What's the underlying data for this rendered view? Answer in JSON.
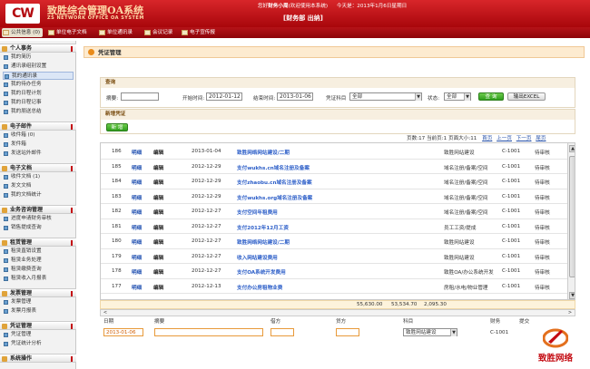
{
  "header": {
    "system_name": "致胜综合管理OA系统",
    "system_name_en": "ZS NETWORK OFFICE OA SYSTEM",
    "welcome_prefix": "您好",
    "user": "财务小周",
    "welcome_suffix": "(欢迎使用本系统)",
    "date_text": "今天是：2013年1月6日星期日",
    "links": "[财务部 出纳]"
  },
  "tabs": [
    "公共信息 (0)",
    "单位电子文档",
    "单位通讯录",
    "会议记录",
    "电子宣传报"
  ],
  "sidebar": {
    "sections": [
      {
        "title": "个人事务",
        "items": [
          "我的简历",
          "通讯录组别设置",
          "我的通讯录",
          "我的待办任务",
          "我的日程计划",
          "我的日程记事",
          "我的朋送总结"
        ]
      },
      {
        "title": "电子邮件",
        "items": [
          "收件箱 (0)",
          "发件箱",
          "发送站外邮件"
        ]
      },
      {
        "title": "电子文档",
        "items": [
          "收件文档 (1)",
          "发文文档",
          "我的文档统计"
        ]
      },
      {
        "title": "业务咨询管理",
        "items": [
          "进度申请财务审核",
          "销售提成查询"
        ]
      },
      {
        "title": "租赁管理",
        "items": [
          "租赁直销设置",
          "租赁业务处理",
          "租赁缴费查询",
          "租赁收入月报表"
        ]
      },
      {
        "title": "发票管理",
        "items": [
          "发票管理",
          "发票月报表"
        ]
      },
      {
        "title": "凭证管理",
        "items": [
          "凭证管理",
          "凭证统计分析"
        ]
      },
      {
        "title": "系统操作",
        "items": []
      }
    ],
    "active_item": "我的通讯录"
  },
  "page": {
    "title": "凭证管理"
  },
  "query": {
    "panel_title": "查询",
    "summary_label": "摘要:",
    "summary_value": "",
    "start_label": "开始时间:",
    "start_value": "2012-01-12",
    "end_label": "结束时间:",
    "end_value": "2013-01-06",
    "subject_label": "凭证科目",
    "subject_value": "全部",
    "status_label": "状态:",
    "status_value": "全部",
    "query_button": "查 询",
    "export_button": "输出EXCEL"
  },
  "add": {
    "panel_title": "新增凭证",
    "add_button": "新 增"
  },
  "pager": {
    "text": "页数:17  当前页:1  页面大小:11",
    "first": "首页",
    "prev": "上一页",
    "next": "下一页",
    "last": "尾页"
  },
  "rows": [
    {
      "id": "186",
      "detail": "明细",
      "edit": "编辑",
      "date": "2013-01-04",
      "summary": "致胜网络网站建设/二期",
      "account": "致胜网站建设",
      "code": "C-1001",
      "status": "待审核"
    },
    {
      "id": "185",
      "detail": "明细",
      "edit": "编辑",
      "date": "2012-12-29",
      "summary": "支付wukhs.cn域名注册及备案",
      "account": "域名注册/备案/空间",
      "code": "C-1001",
      "status": "待审核"
    },
    {
      "id": "184",
      "detail": "明细",
      "edit": "编辑",
      "date": "2012-12-29",
      "summary": "支付zhaobu.cn域名注册及备案",
      "account": "域名注册/备案/空间",
      "code": "C-1001",
      "status": "待审核"
    },
    {
      "id": "183",
      "detail": "明细",
      "edit": "编辑",
      "date": "2012-12-29",
      "summary": "支付wukhs.org域名注册及备案",
      "account": "域名注册/备案/空间",
      "code": "C-1001",
      "status": "待审核"
    },
    {
      "id": "182",
      "detail": "明细",
      "edit": "编辑",
      "date": "2012-12-27",
      "summary": "支付空间年租费用",
      "account": "域名注册/备案/空间",
      "code": "C-1001",
      "status": "待审核"
    },
    {
      "id": "181",
      "detail": "明细",
      "edit": "编辑",
      "date": "2012-12-27",
      "summary": "支付2012年12月工资",
      "account": "员工工资/提成",
      "code": "C-1001",
      "status": "待审核"
    },
    {
      "id": "180",
      "detail": "明细",
      "edit": "编辑",
      "date": "2012-12-27",
      "summary": "致胜网络网站建设/二期",
      "account": "致胜网站建设",
      "code": "C-1001",
      "status": "待审核"
    },
    {
      "id": "179",
      "detail": "明细",
      "edit": "编辑",
      "date": "2012-12-27",
      "summary": "收入网站建设费用",
      "account": "致胜网站建设",
      "code": "C-1001",
      "status": "待审核"
    },
    {
      "id": "178",
      "detail": "明细",
      "edit": "编辑",
      "date": "2012-12-27",
      "summary": "支付OA系统开发费用",
      "account": "致胜OA/办公系统开发",
      "code": "C-1001",
      "status": "待审核"
    },
    {
      "id": "177",
      "detail": "明细",
      "edit": "编辑",
      "date": "2012-12-13",
      "summary": "支付办公房租物业费",
      "account": "房租/水电/物业管理",
      "code": "C-1001",
      "status": "待审核"
    }
  ],
  "totals": {
    "debit": "55,630.00",
    "credit": "53,534.70",
    "balance": "2,095.30"
  },
  "entry": {
    "headers": {
      "date": "日期",
      "summary": "摘要",
      "debit": "借方",
      "credit": "贷方",
      "subject": "科目",
      "finance": "财务",
      "submit": "提交"
    },
    "date_value": "2013-01-06",
    "subject_value": "致胜网站建设",
    "code_value": "C-1001"
  },
  "watermark": {
    "text": "致胜网络"
  }
}
